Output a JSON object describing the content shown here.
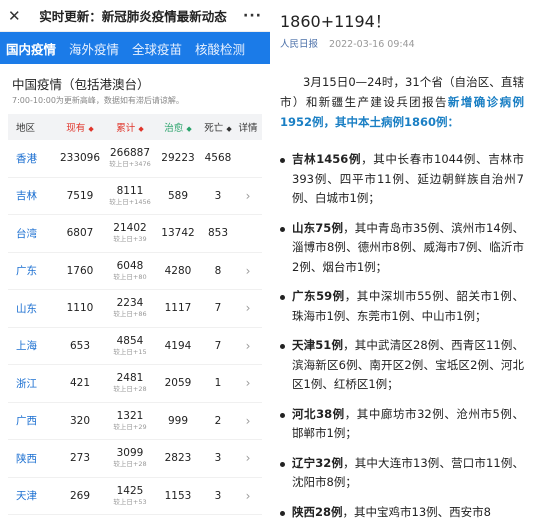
{
  "left": {
    "topbar": {
      "close_glyph": "✕",
      "title": "实时更新：新冠肺炎疫情最新动态",
      "more_glyph": "···"
    },
    "tabs": [
      "国内疫情",
      "海外疫情",
      "全球疫苗",
      "核酸检测"
    ],
    "section_title": "中国疫情（包括港澳台）",
    "section_note": "7:00-10:00为更新高峰，数据如有滞后请谅解。",
    "table": {
      "headers": {
        "region": "地区",
        "exist": "现有",
        "total": "累计",
        "cured": "治愈",
        "dead": "死亡",
        "detail": "详情"
      },
      "rows": [
        {
          "region": "香港",
          "exist": "233096",
          "total": "266887",
          "delta": "较上日+3476",
          "cured": "29223",
          "dead": "4568",
          "arrow": ""
        },
        {
          "region": "吉林",
          "exist": "7519",
          "total": "8111",
          "delta": "较上日+1456",
          "cured": "589",
          "dead": "3",
          "arrow": "›"
        },
        {
          "region": "台湾",
          "exist": "6807",
          "total": "21402",
          "delta": "较上日+39",
          "cured": "13742",
          "dead": "853",
          "arrow": ""
        },
        {
          "region": "广东",
          "exist": "1760",
          "total": "6048",
          "delta": "较上日+80",
          "cured": "4280",
          "dead": "8",
          "arrow": "›"
        },
        {
          "region": "山东",
          "exist": "1110",
          "total": "2234",
          "delta": "较上日+86",
          "cured": "1117",
          "dead": "7",
          "arrow": "›"
        },
        {
          "region": "上海",
          "exist": "653",
          "total": "4854",
          "delta": "较上日+15",
          "cured": "4194",
          "dead": "7",
          "arrow": "›"
        },
        {
          "region": "浙江",
          "exist": "421",
          "total": "2481",
          "delta": "较上日+28",
          "cured": "2059",
          "dead": "1",
          "arrow": "›"
        },
        {
          "region": "广西",
          "exist": "320",
          "total": "1321",
          "delta": "较上日+29",
          "cured": "999",
          "dead": "2",
          "arrow": "›"
        },
        {
          "region": "陕西",
          "exist": "273",
          "total": "3099",
          "delta": "较上日+28",
          "cured": "2823",
          "dead": "3",
          "arrow": "›"
        },
        {
          "region": "天津",
          "exist": "269",
          "total": "1425",
          "delta": "较上日+53",
          "cured": "1153",
          "dead": "3",
          "arrow": "›"
        }
      ]
    }
  },
  "right": {
    "heading": "1860+1194！",
    "source": "人民日报",
    "timestamp": "2022-03-16 09:44",
    "intro_plain": "3月15日0—24时，31个省（自治区、直辖市）和新疆生产建设兵团报告",
    "intro_highlight": "新增确诊病例1952例，其中本土病例1860例：",
    "bullets": [
      {
        "province": "吉林1456例",
        "text": "，其中长春市1044例、吉林市393例、四平市11例、延边朝鲜族自治州7例、白城市1例；"
      },
      {
        "province": "山东75例",
        "text": "，其中青岛市35例、滨州市14例、淄博市8例、德州市8例、威海市7例、临沂市2例、烟台市1例；"
      },
      {
        "province": "广东59例",
        "text": "，其中深圳市55例、韶关市1例、珠海市1例、东莞市1例、中山市1例；"
      },
      {
        "province": "天津51例",
        "text": "，其中武清区28例、西青区11例、滨海新区6例、南开区2例、宝坻区2例、河北区1例、红桥区1例；"
      },
      {
        "province": "河北38例",
        "text": "，其中廊坊市32例、沧州市5例、邯郸市1例；"
      },
      {
        "province": "辽宁32例",
        "text": "，其中大连市13例、营口市11例、沈阳市8例；"
      },
      {
        "province": "陕西28例",
        "text": "，其中宝鸡市13例、西安市8"
      }
    ]
  }
}
